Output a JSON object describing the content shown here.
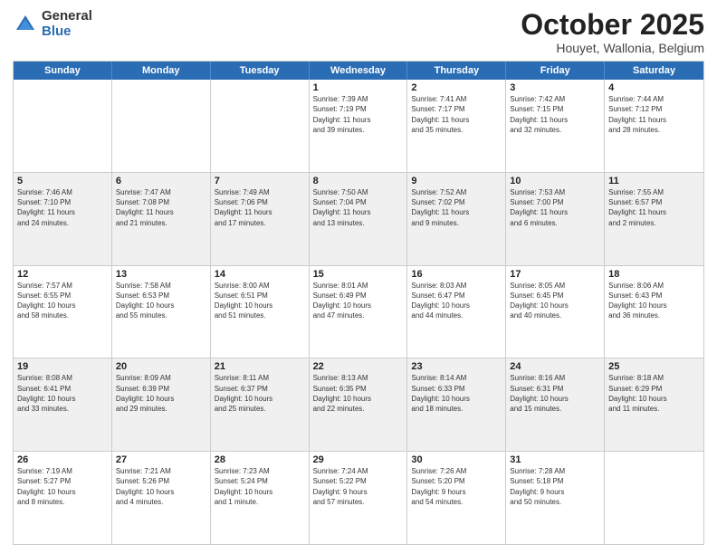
{
  "logo": {
    "general": "General",
    "blue": "Blue"
  },
  "title": "October 2025",
  "subtitle": "Houyet, Wallonia, Belgium",
  "header_days": [
    "Sunday",
    "Monday",
    "Tuesday",
    "Wednesday",
    "Thursday",
    "Friday",
    "Saturday"
  ],
  "rows": [
    {
      "alt": false,
      "cells": [
        {
          "day": "",
          "content": ""
        },
        {
          "day": "",
          "content": ""
        },
        {
          "day": "",
          "content": ""
        },
        {
          "day": "1",
          "content": "Sunrise: 7:39 AM\nSunset: 7:19 PM\nDaylight: 11 hours\nand 39 minutes."
        },
        {
          "day": "2",
          "content": "Sunrise: 7:41 AM\nSunset: 7:17 PM\nDaylight: 11 hours\nand 35 minutes."
        },
        {
          "day": "3",
          "content": "Sunrise: 7:42 AM\nSunset: 7:15 PM\nDaylight: 11 hours\nand 32 minutes."
        },
        {
          "day": "4",
          "content": "Sunrise: 7:44 AM\nSunset: 7:12 PM\nDaylight: 11 hours\nand 28 minutes."
        }
      ]
    },
    {
      "alt": true,
      "cells": [
        {
          "day": "5",
          "content": "Sunrise: 7:46 AM\nSunset: 7:10 PM\nDaylight: 11 hours\nand 24 minutes."
        },
        {
          "day": "6",
          "content": "Sunrise: 7:47 AM\nSunset: 7:08 PM\nDaylight: 11 hours\nand 21 minutes."
        },
        {
          "day": "7",
          "content": "Sunrise: 7:49 AM\nSunset: 7:06 PM\nDaylight: 11 hours\nand 17 minutes."
        },
        {
          "day": "8",
          "content": "Sunrise: 7:50 AM\nSunset: 7:04 PM\nDaylight: 11 hours\nand 13 minutes."
        },
        {
          "day": "9",
          "content": "Sunrise: 7:52 AM\nSunset: 7:02 PM\nDaylight: 11 hours\nand 9 minutes."
        },
        {
          "day": "10",
          "content": "Sunrise: 7:53 AM\nSunset: 7:00 PM\nDaylight: 11 hours\nand 6 minutes."
        },
        {
          "day": "11",
          "content": "Sunrise: 7:55 AM\nSunset: 6:57 PM\nDaylight: 11 hours\nand 2 minutes."
        }
      ]
    },
    {
      "alt": false,
      "cells": [
        {
          "day": "12",
          "content": "Sunrise: 7:57 AM\nSunset: 6:55 PM\nDaylight: 10 hours\nand 58 minutes."
        },
        {
          "day": "13",
          "content": "Sunrise: 7:58 AM\nSunset: 6:53 PM\nDaylight: 10 hours\nand 55 minutes."
        },
        {
          "day": "14",
          "content": "Sunrise: 8:00 AM\nSunset: 6:51 PM\nDaylight: 10 hours\nand 51 minutes."
        },
        {
          "day": "15",
          "content": "Sunrise: 8:01 AM\nSunset: 6:49 PM\nDaylight: 10 hours\nand 47 minutes."
        },
        {
          "day": "16",
          "content": "Sunrise: 8:03 AM\nSunset: 6:47 PM\nDaylight: 10 hours\nand 44 minutes."
        },
        {
          "day": "17",
          "content": "Sunrise: 8:05 AM\nSunset: 6:45 PM\nDaylight: 10 hours\nand 40 minutes."
        },
        {
          "day": "18",
          "content": "Sunrise: 8:06 AM\nSunset: 6:43 PM\nDaylight: 10 hours\nand 36 minutes."
        }
      ]
    },
    {
      "alt": true,
      "cells": [
        {
          "day": "19",
          "content": "Sunrise: 8:08 AM\nSunset: 6:41 PM\nDaylight: 10 hours\nand 33 minutes."
        },
        {
          "day": "20",
          "content": "Sunrise: 8:09 AM\nSunset: 6:39 PM\nDaylight: 10 hours\nand 29 minutes."
        },
        {
          "day": "21",
          "content": "Sunrise: 8:11 AM\nSunset: 6:37 PM\nDaylight: 10 hours\nand 25 minutes."
        },
        {
          "day": "22",
          "content": "Sunrise: 8:13 AM\nSunset: 6:35 PM\nDaylight: 10 hours\nand 22 minutes."
        },
        {
          "day": "23",
          "content": "Sunrise: 8:14 AM\nSunset: 6:33 PM\nDaylight: 10 hours\nand 18 minutes."
        },
        {
          "day": "24",
          "content": "Sunrise: 8:16 AM\nSunset: 6:31 PM\nDaylight: 10 hours\nand 15 minutes."
        },
        {
          "day": "25",
          "content": "Sunrise: 8:18 AM\nSunset: 6:29 PM\nDaylight: 10 hours\nand 11 minutes."
        }
      ]
    },
    {
      "alt": false,
      "cells": [
        {
          "day": "26",
          "content": "Sunrise: 7:19 AM\nSunset: 5:27 PM\nDaylight: 10 hours\nand 8 minutes."
        },
        {
          "day": "27",
          "content": "Sunrise: 7:21 AM\nSunset: 5:26 PM\nDaylight: 10 hours\nand 4 minutes."
        },
        {
          "day": "28",
          "content": "Sunrise: 7:23 AM\nSunset: 5:24 PM\nDaylight: 10 hours\nand 1 minute."
        },
        {
          "day": "29",
          "content": "Sunrise: 7:24 AM\nSunset: 5:22 PM\nDaylight: 9 hours\nand 57 minutes."
        },
        {
          "day": "30",
          "content": "Sunrise: 7:26 AM\nSunset: 5:20 PM\nDaylight: 9 hours\nand 54 minutes."
        },
        {
          "day": "31",
          "content": "Sunrise: 7:28 AM\nSunset: 5:18 PM\nDaylight: 9 hours\nand 50 minutes."
        },
        {
          "day": "",
          "content": ""
        }
      ]
    }
  ]
}
